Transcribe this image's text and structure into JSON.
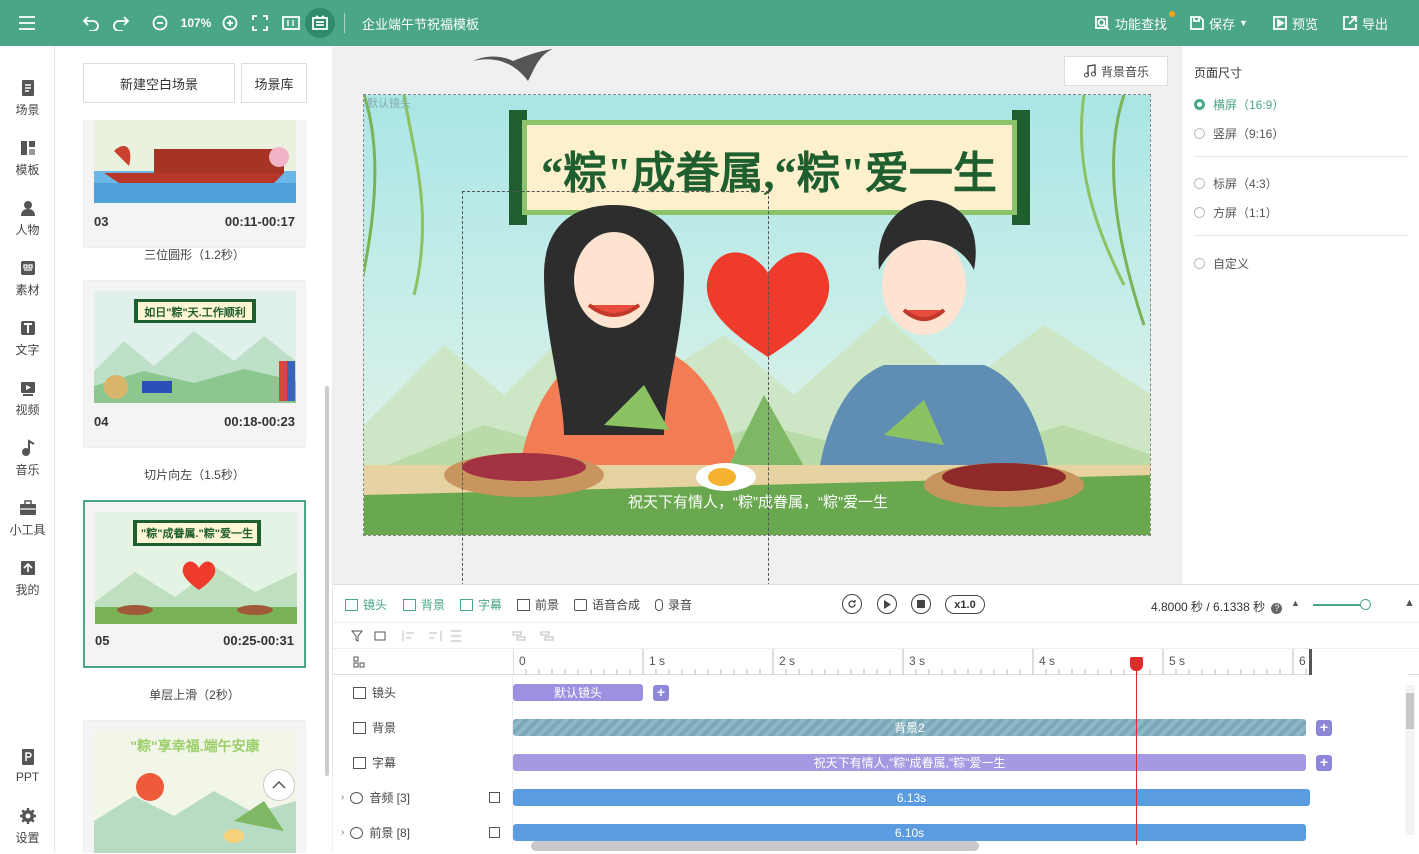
{
  "toolbar": {
    "zoom": "107%",
    "title": "企业端午节祝福模板",
    "find_label": "功能查找",
    "save_label": "保存",
    "preview_label": "预览",
    "export_label": "导出"
  },
  "nav": {
    "items": [
      {
        "label": "场景",
        "icon": "scene-icon"
      },
      {
        "label": "模板",
        "icon": "template-icon"
      },
      {
        "label": "人物",
        "icon": "person-icon"
      },
      {
        "label": "素材",
        "icon": "material-icon"
      },
      {
        "label": "文字",
        "icon": "text-icon"
      },
      {
        "label": "视频",
        "icon": "video-icon"
      },
      {
        "label": "音乐",
        "icon": "music-icon"
      },
      {
        "label": "小工具",
        "icon": "toolbox-icon"
      },
      {
        "label": "我的",
        "icon": "upload-icon"
      }
    ],
    "ppt_label": "PPT",
    "settings_label": "设置"
  },
  "scenes": {
    "new_label": "新建空白场景",
    "library_label": "场景库",
    "cards": [
      {
        "num": "03",
        "time": "00:11-00:17",
        "transition": "三位圆形（1.2秒）"
      },
      {
        "num": "04",
        "time": "00:18-00:23",
        "transition": "切片向左（1.5秒）",
        "banner": "如日\"粽\"天.工作顺利"
      },
      {
        "num": "05",
        "time": "00:25-00:31",
        "transition": "单层上滑（2秒）",
        "banner": "\"粽\"成眷属.\"粽\"爱一生"
      },
      {
        "banner": "\"粽\"享幸福.端午安康"
      }
    ]
  },
  "canvas": {
    "bgm_label": "背景音乐",
    "camera_label": "默认镜头",
    "headline": "“粽\"成眷属,“粽\"爱一生",
    "subtitle": "祝天下有情人，“粽”成眷属，“粽”爱一生"
  },
  "page_size": {
    "title": "页面尺寸",
    "options": [
      {
        "label": "横屏（16:9）",
        "selected": true
      },
      {
        "label": "竖屏（9:16）",
        "selected": false
      },
      {
        "label": "标屏（4:3）",
        "selected": false
      },
      {
        "label": "方屏（1:1）",
        "selected": false
      },
      {
        "label": "自定义",
        "selected": false
      }
    ]
  },
  "timeline": {
    "tabs": [
      "镜头",
      "背景",
      "字幕",
      "前景",
      "语音合成",
      "录音"
    ],
    "speed": "x1.0",
    "time_info": "4.8000 秒 / 6.1338 秒",
    "ruler": [
      "0",
      "1 s",
      "2 s",
      "3 s",
      "4 s",
      "5 s",
      "6"
    ],
    "tracks": [
      {
        "label": "镜头",
        "bar": "默认镜头"
      },
      {
        "label": "背景",
        "bar": "背景2"
      },
      {
        "label": "字幕",
        "bar": "祝天下有情人,\"粽\"成眷属,\"粽\"爱一生"
      },
      {
        "label": "音频 [3]",
        "bar": "6.13s"
      },
      {
        "label": "前景 [8]",
        "bar": "6.10s"
      }
    ],
    "playhead_seconds": 4.8
  },
  "colors": {
    "accent": "#4aa684",
    "purple": "#9b91e0",
    "blue": "#5b9be0",
    "red": "#e02b2b"
  }
}
